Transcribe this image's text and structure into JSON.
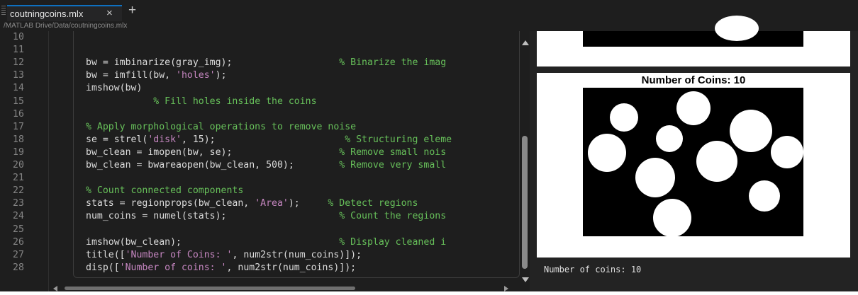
{
  "tab": {
    "title": "coutningcoins.mlx",
    "close_glyph": "×",
    "add_glyph": "+"
  },
  "path": "/MATLAB Drive/Data/coutningcoins.mlx",
  "editor": {
    "line_numbers": [
      "10",
      "11",
      "12",
      "13",
      "14",
      "15",
      "16",
      "17",
      "18",
      "19",
      "20",
      "21",
      "22",
      "23",
      "24",
      "25",
      "26",
      "27",
      "28"
    ],
    "lines": [
      [],
      [],
      [
        {
          "t": "bw = imbinarize(gray_img);                   "
        },
        {
          "t": "% Binarize the imag",
          "c": "cm"
        }
      ],
      [
        {
          "t": "bw = imfill(bw, "
        },
        {
          "t": "'holes'",
          "c": "str"
        },
        {
          "t": ");"
        }
      ],
      [
        {
          "t": "imshow(bw)"
        }
      ],
      [
        {
          "t": "            "
        },
        {
          "t": "% Fill holes inside the coins",
          "c": "cm"
        }
      ],
      [],
      [
        {
          "t": "% Apply morphological operations to remove noise",
          "c": "cm"
        }
      ],
      [
        {
          "t": "se = strel("
        },
        {
          "t": "'disk'",
          "c": "str"
        },
        {
          "t": ", 15);                       "
        },
        {
          "t": "% Structuring eleme",
          "c": "cm"
        }
      ],
      [
        {
          "t": "bw_clean = imopen(bw, se);                   "
        },
        {
          "t": "% Remove small nois",
          "c": "cm"
        }
      ],
      [
        {
          "t": "bw_clean = bwareaopen(bw_clean, 500);        "
        },
        {
          "t": "% Remove very small",
          "c": "cm"
        }
      ],
      [],
      [
        {
          "t": "% Count connected components",
          "c": "cm"
        }
      ],
      [
        {
          "t": "stats = regionprops(bw_clean, "
        },
        {
          "t": "'Area'",
          "c": "str"
        },
        {
          "t": ");     "
        },
        {
          "t": "% Detect regions",
          "c": "cm"
        }
      ],
      [
        {
          "t": "num_coins = numel(stats);                    "
        },
        {
          "t": "% Count the regions",
          "c": "cm"
        }
      ],
      [],
      [
        {
          "t": "imshow(bw_clean);                            "
        },
        {
          "t": "% Display cleaned i",
          "c": "cm"
        }
      ],
      [
        {
          "t": "title(["
        },
        {
          "t": "'Number of Coins: '",
          "c": "str"
        },
        {
          "t": ", num2str(num_coins)]);"
        }
      ],
      [
        {
          "t": "disp(["
        },
        {
          "t": "'Number of coins: '",
          "c": "str"
        },
        {
          "t": ", num2str(num_coins)]);"
        }
      ]
    ]
  },
  "output": {
    "figure_title": "Number of Coins: 10",
    "coin_count": 10,
    "console_text": "Number of coins: 10"
  },
  "colors": {
    "comment": "#67c05a",
    "string": "#c586c0",
    "background": "#1e1e1e",
    "tab_accent": "#0e70c0"
  }
}
